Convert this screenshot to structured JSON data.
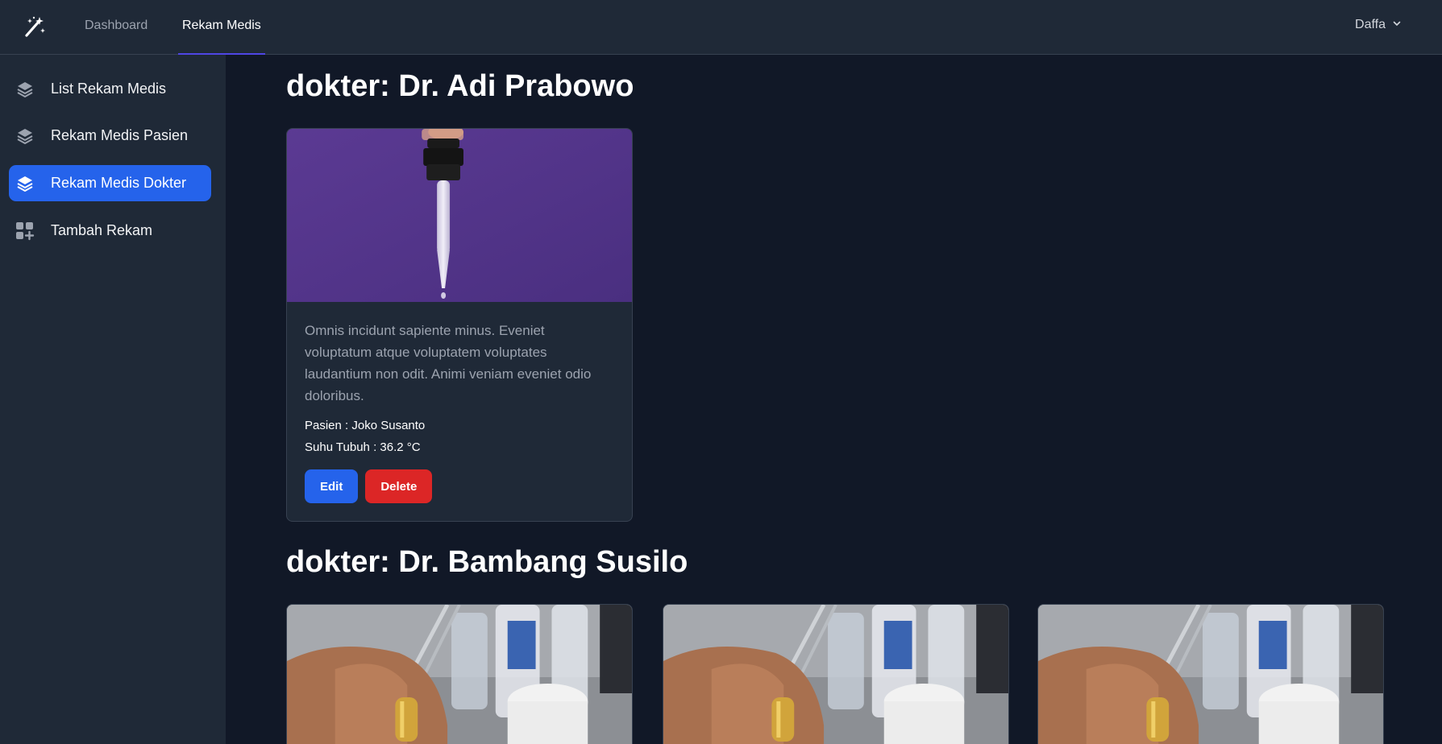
{
  "nav": {
    "links": [
      {
        "label": "Dashboard"
      },
      {
        "label": "Rekam Medis"
      }
    ],
    "user": "Daffa",
    "logo_icon": "magic-wand-icon"
  },
  "sidebar": {
    "items": [
      {
        "label": "List Rekam Medis",
        "icon": "layers-icon"
      },
      {
        "label": "Rekam Medis Pasien",
        "icon": "layers-icon"
      },
      {
        "label": "Rekam Medis Dokter",
        "icon": "layers-icon",
        "active": true
      },
      {
        "label": "Tambah Rekam",
        "icon": "grid-plus-icon"
      }
    ]
  },
  "groups": [
    {
      "heading": "dokter: Dr. Adi Prabowo",
      "cards": [
        {
          "image": "dropper-photo",
          "description": "Omnis incidunt sapiente minus. Eveniet voluptatum atque voluptatem voluptates laudantium non odit. Animi veniam eveniet odio doloribus.",
          "pasien": "Pasien : Joko Susanto",
          "suhu": "Suhu Tubuh : 36.2 °C",
          "edit_label": "Edit",
          "delete_label": "Delete"
        }
      ]
    },
    {
      "heading": "dokter: Dr. Bambang Susilo",
      "cards": [
        {
          "image": "pharmacy-photo"
        },
        {
          "image": "pharmacy-photo"
        },
        {
          "image": "pharmacy-photo"
        }
      ]
    }
  ],
  "colors": {
    "background": "#111827",
    "panel": "#1f2937",
    "primary": "#2563eb",
    "danger": "#dc2626",
    "nav_accent": "#4f46e5"
  }
}
